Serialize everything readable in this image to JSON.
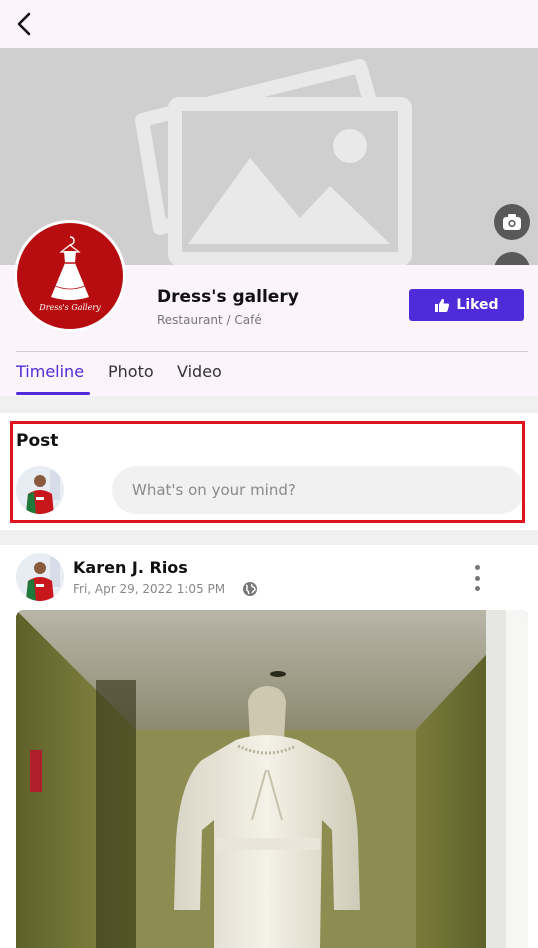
{
  "page": {
    "name": "Dress's gallery",
    "category": "Restaurant / Café",
    "logo_text": "Dress's Gallery"
  },
  "actions": {
    "liked_label": "Liked"
  },
  "tabs": [
    {
      "label": "Timeline",
      "active": true
    },
    {
      "label": "Photo",
      "active": false
    },
    {
      "label": "Video",
      "active": false
    }
  ],
  "composer": {
    "title": "Post",
    "placeholder": "What's on your mind?"
  },
  "feed": {
    "author": "Karen J. Rios",
    "date": "Fri, Apr 29, 2022 1:05 PM",
    "visibility_icon": "globe-icon"
  },
  "colors": {
    "accent": "#4f2bd9",
    "highlight": "#e0141e",
    "logo_bg": "#b80d10"
  }
}
